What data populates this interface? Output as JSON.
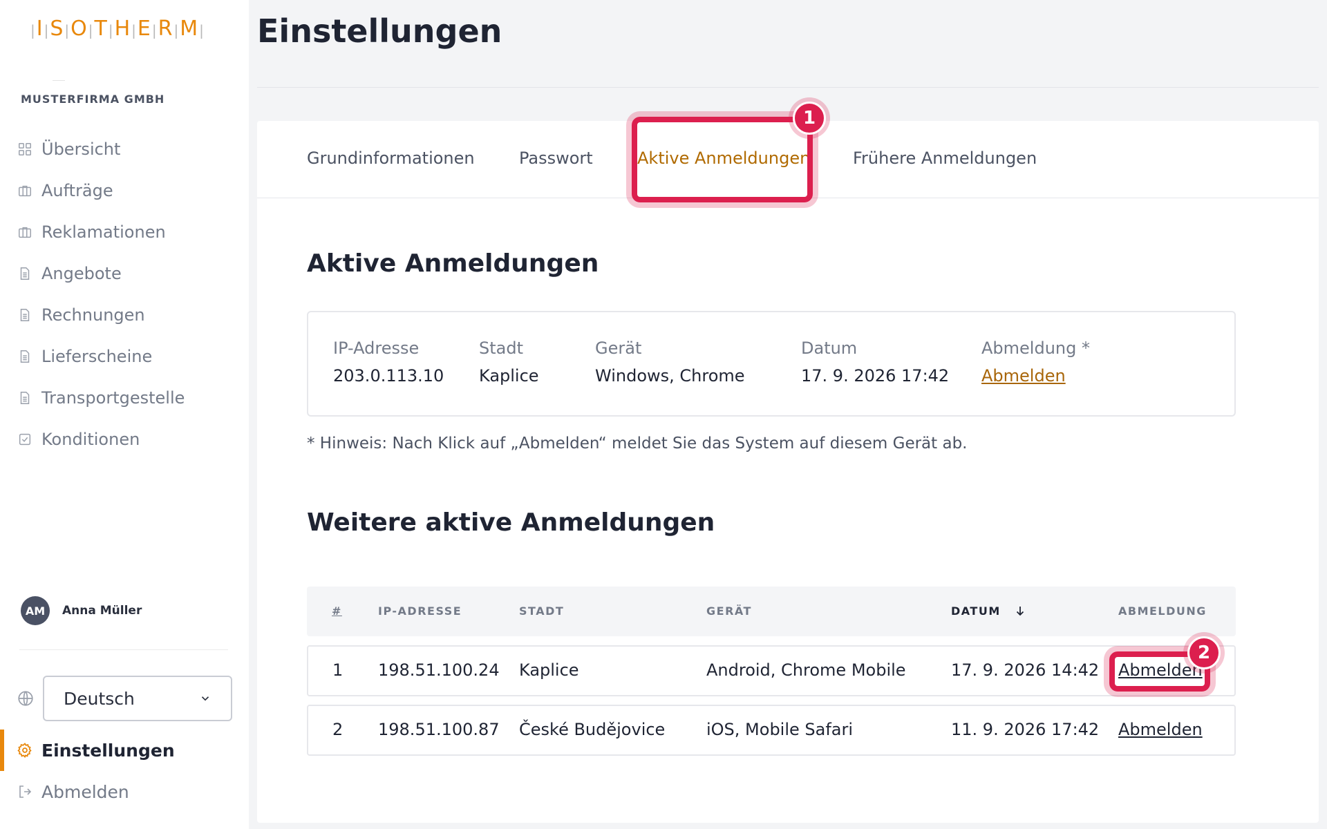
{
  "logo": {
    "letters": [
      "I",
      "S",
      "O",
      "T",
      "H",
      "E",
      "R",
      "M"
    ]
  },
  "sidebar": {
    "company": "MUSTERFIRMA GMBH",
    "items": [
      {
        "label": "Übersicht",
        "icon": "grid-icon"
      },
      {
        "label": "Aufträge",
        "icon": "briefcase-icon"
      },
      {
        "label": "Reklamationen",
        "icon": "briefcase-icon"
      },
      {
        "label": "Angebote",
        "icon": "document-icon"
      },
      {
        "label": "Rechnungen",
        "icon": "document-icon"
      },
      {
        "label": "Lieferscheine",
        "icon": "document-icon"
      },
      {
        "label": "Transportgestelle",
        "icon": "document-icon"
      },
      {
        "label": "Konditionen",
        "icon": "checkbox-icon"
      }
    ],
    "user": {
      "initials": "AM",
      "name": "Anna Müller"
    },
    "language": "Deutsch",
    "settings_label": "Einstellungen",
    "logout_label": "Abmelden"
  },
  "main": {
    "title": "Einstellungen",
    "tabs": [
      {
        "label": "Grundinformationen"
      },
      {
        "label": "Passwort"
      },
      {
        "label": "Aktive Anmeldungen"
      },
      {
        "label": "Frühere Anmeldungen"
      }
    ],
    "active_tab_index": 2,
    "active_section": {
      "title": "Aktive Anmeldungen",
      "labels": {
        "ip": "IP-Adresse",
        "city": "Stadt",
        "device": "Gerät",
        "date": "Datum",
        "logout": "Abmeldung *"
      },
      "values": {
        "ip": "203.0.113.10",
        "city": "Kaplice",
        "device": "Windows, Chrome",
        "date": "17. 9. 2026 17:42",
        "logout": "Abmelden"
      }
    },
    "note": "* Hinweis: Nach Klick auf „Abmelden“ meldet Sie das System auf diesem Gerät ab.",
    "other_section": {
      "title": "Weitere aktive Anmeldungen",
      "headers": {
        "num": "#",
        "ip": "IP-ADRESSE",
        "city": "STADT",
        "device": "GERÄT",
        "date": "DATUM",
        "logout": "ABMELDUNG"
      },
      "sort": {
        "column": "date",
        "direction": "desc"
      },
      "rows": [
        {
          "num": "1",
          "ip": "198.51.100.24",
          "city": "Kaplice",
          "device": "Android, Chrome Mobile",
          "date": "17. 9. 2026 14:42",
          "action": "Abmelden"
        },
        {
          "num": "2",
          "ip": "198.51.100.87",
          "city": "České Budějovice",
          "device": "iOS, Mobile Safari",
          "date": "11. 9. 2026 17:42",
          "action": "Abmelden"
        }
      ]
    }
  },
  "annotations": {
    "badge1": "1",
    "badge2": "2"
  },
  "colors": {
    "accent": "#e8880c",
    "link": "#a8660a",
    "highlight": "#dc1f4e"
  }
}
